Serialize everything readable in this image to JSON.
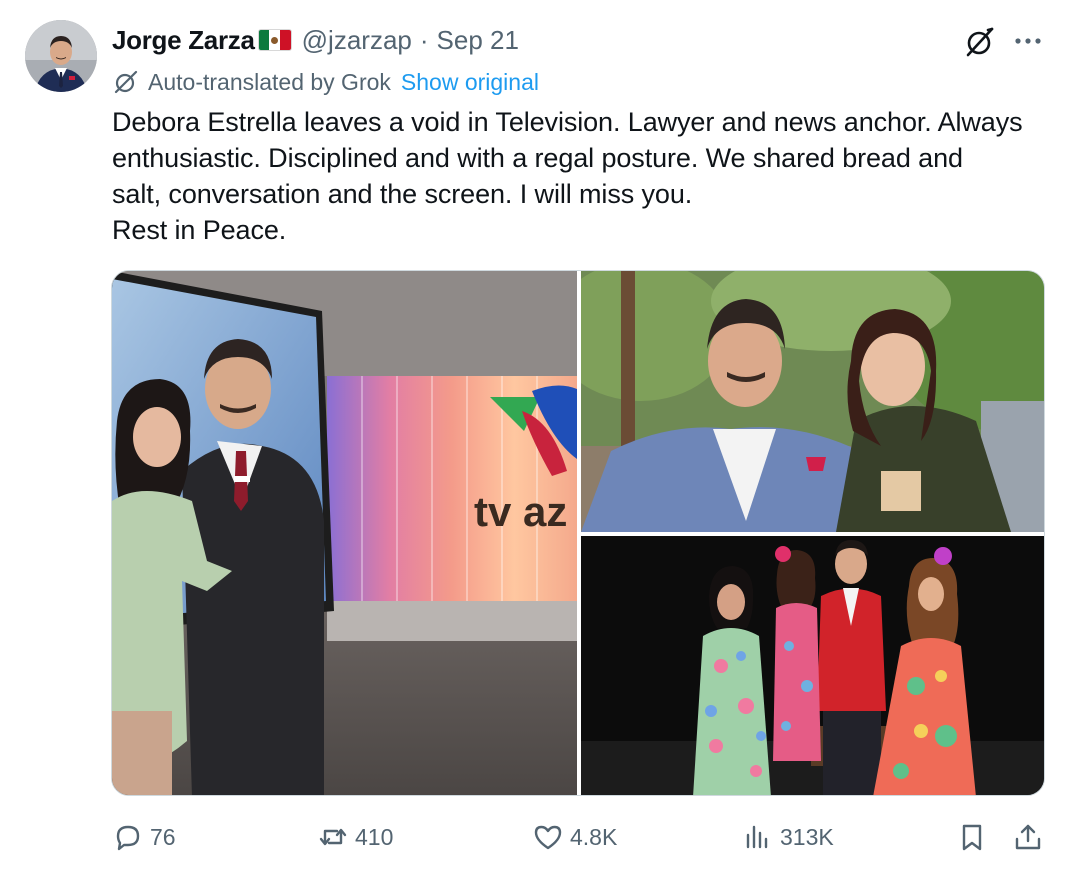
{
  "author": {
    "display_name": "Jorge Zarza",
    "flag_icon": "mexico-flag-icon",
    "handle": "@jzarzap",
    "separator": "·",
    "date": "Sep 21"
  },
  "translation": {
    "label": "Auto-translated by Grok",
    "show_original": "Show original"
  },
  "body": {
    "lines": [
      "Debora Estrella leaves a void in Television. Lawyer and news anchor. Always",
      "enthusiastic. Disciplined and with a regal posture. We shared bread and",
      "salt, conversation and the screen. I will miss you.",
      "Rest in Peace."
    ]
  },
  "media": {
    "studio_logo_text": "tv az"
  },
  "actions": {
    "replies": "76",
    "reposts": "410",
    "likes": "4.8K",
    "views": "313K"
  },
  "colors": {
    "text": "#0f1419",
    "secondary": "#536471",
    "link": "#1d9bf0",
    "border": "#cfd9de"
  }
}
